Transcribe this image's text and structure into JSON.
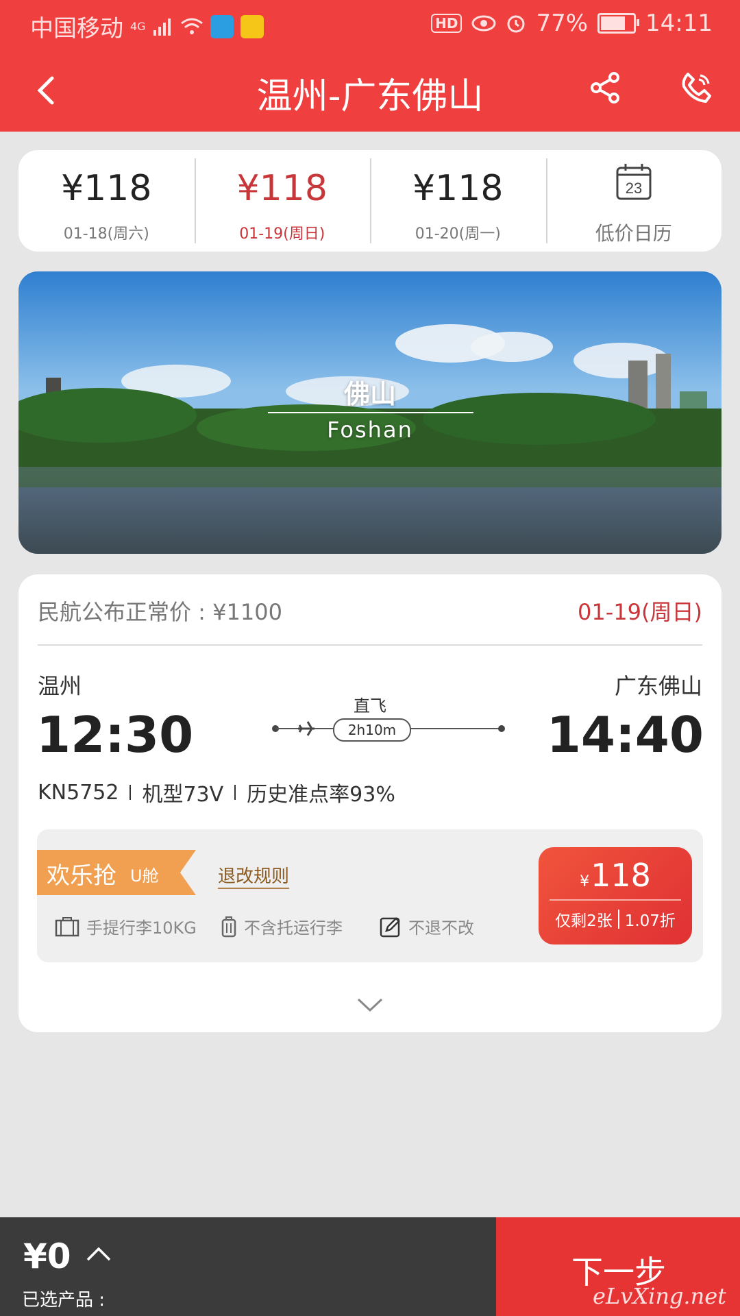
{
  "status_bar": {
    "carrier": "中国移动",
    "network": "4G",
    "hd": "HD",
    "battery": "77%",
    "battery_level": 0.77,
    "time": "14:11"
  },
  "header": {
    "title": "温州-广东佛山",
    "back_icon": "chevron-left-icon",
    "share_icon": "share-icon",
    "phone_icon": "phone-icon"
  },
  "dates": [
    {
      "price": "¥118",
      "label": "01-18(周六)",
      "active": false
    },
    {
      "price": "¥118",
      "label": "01-19(周日)",
      "active": true
    },
    {
      "price": "¥118",
      "label": "01-20(周一)",
      "active": false
    }
  ],
  "calendar": {
    "day": "23",
    "label": "低价日历"
  },
  "banner": {
    "city_cn": "佛山",
    "city_en": "Foshan"
  },
  "flight": {
    "standard_price": "民航公布正常价 : ¥1100",
    "date": "01-19(周日)",
    "dep_city": "温州",
    "arr_city": "广东佛山",
    "dep_time": "12:30",
    "arr_time": "14:40",
    "direct": "直飞",
    "duration": "2h10m",
    "flight_no": "KN5752",
    "aircraft": "机型73V",
    "on_time": "历史准点率93%"
  },
  "offer": {
    "tag": "欢乐抢",
    "cabin": "U舱",
    "refund_rules": "退改规则",
    "features": [
      "手提行李10KG",
      "不含托运行李",
      "不退不改"
    ],
    "currency": "¥",
    "price": "118",
    "remaining": "仅剩2张",
    "discount": "1.07折"
  },
  "bottom": {
    "total": "¥0",
    "selected_label": "已选产品 :",
    "next": "下一步",
    "watermark": "eLvXing.net"
  },
  "colors": {
    "brand_red": "#ef3f3f",
    "price_red": "#c9363a",
    "tag_orange": "#f0a050"
  }
}
